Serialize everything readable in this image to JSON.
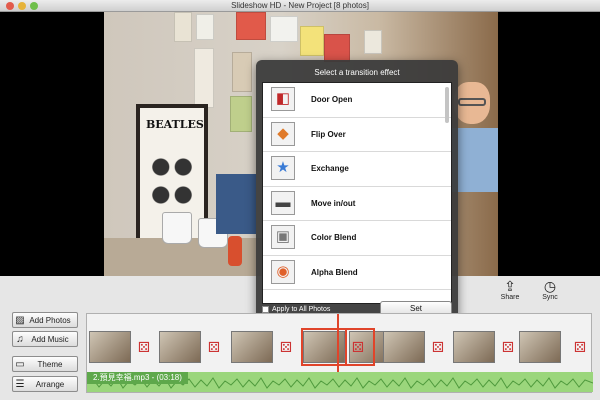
{
  "window": {
    "title": "Slideshow HD - New Project [8 photos]"
  },
  "poster_text": "BEATLES",
  "popup": {
    "title": "Select a transition effect",
    "effects": [
      {
        "label": "Door Open",
        "icon": "door-open-icon"
      },
      {
        "label": "Flip Over",
        "icon": "flip-over-icon"
      },
      {
        "label": "Exchange",
        "icon": "exchange-icon"
      },
      {
        "label": "Move in/out",
        "icon": "move-inout-icon"
      },
      {
        "label": "Color Blend",
        "icon": "color-blend-icon"
      },
      {
        "label": "Alpha Blend",
        "icon": "alpha-blend-icon"
      }
    ],
    "apply_all": "Apply to All Photos",
    "set_label": "Set"
  },
  "toolbar": {
    "add_photos": "Add Photos",
    "add_music": "Add Music",
    "theme": "Theme",
    "arrange": "Arrange",
    "share": "Share",
    "sync": "Sync"
  },
  "timeline": {
    "music_label": "2.預見幸福.mp3 - (03:18)"
  },
  "colors": {
    "accent": "#e0442a",
    "music": "#9bd67c"
  }
}
